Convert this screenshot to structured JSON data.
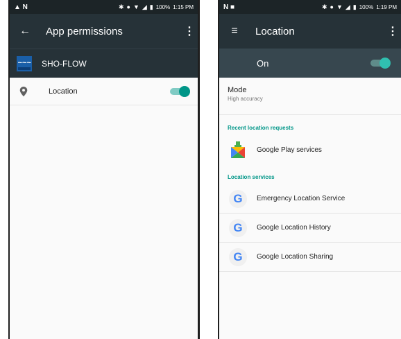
{
  "left_screen": {
    "status_bar": {
      "left_icons": "▲ N",
      "battery": "100%",
      "time": "1:15 PM"
    },
    "toolbar": {
      "back_icon": "arrow-back-icon",
      "title": "App permissions",
      "menu_icon": "overflow-menu-icon"
    },
    "app": {
      "name": "SHO-FLOW",
      "logo_text": "~~~"
    },
    "permissions": [
      {
        "label": "Location",
        "enabled": true
      }
    ]
  },
  "right_screen": {
    "status_bar": {
      "left_icons": "N ■",
      "battery": "100%",
      "time": "1:19 PM"
    },
    "toolbar": {
      "menu_icon": "hamburger-icon",
      "title": "Location",
      "overflow_icon": "overflow-menu-icon"
    },
    "master_switch": {
      "label": "On",
      "enabled": true
    },
    "mode": {
      "title": "Mode",
      "value": "High accuracy"
    },
    "recent_requests": {
      "title": "Recent location requests",
      "items": [
        {
          "label": "Google Play services",
          "icon": "google-play-services-icon"
        }
      ]
    },
    "location_services": {
      "title": "Location services",
      "items": [
        {
          "label": "Emergency Location Service",
          "icon": "google-g-icon"
        },
        {
          "label": "Google Location History",
          "icon": "google-g-icon"
        },
        {
          "label": "Google Location Sharing",
          "icon": "google-g-icon"
        }
      ]
    }
  },
  "colors": {
    "toolbar": "#263238",
    "status_bar": "#1c2427",
    "accent": "#009688",
    "google_blue": "#4285f4"
  }
}
